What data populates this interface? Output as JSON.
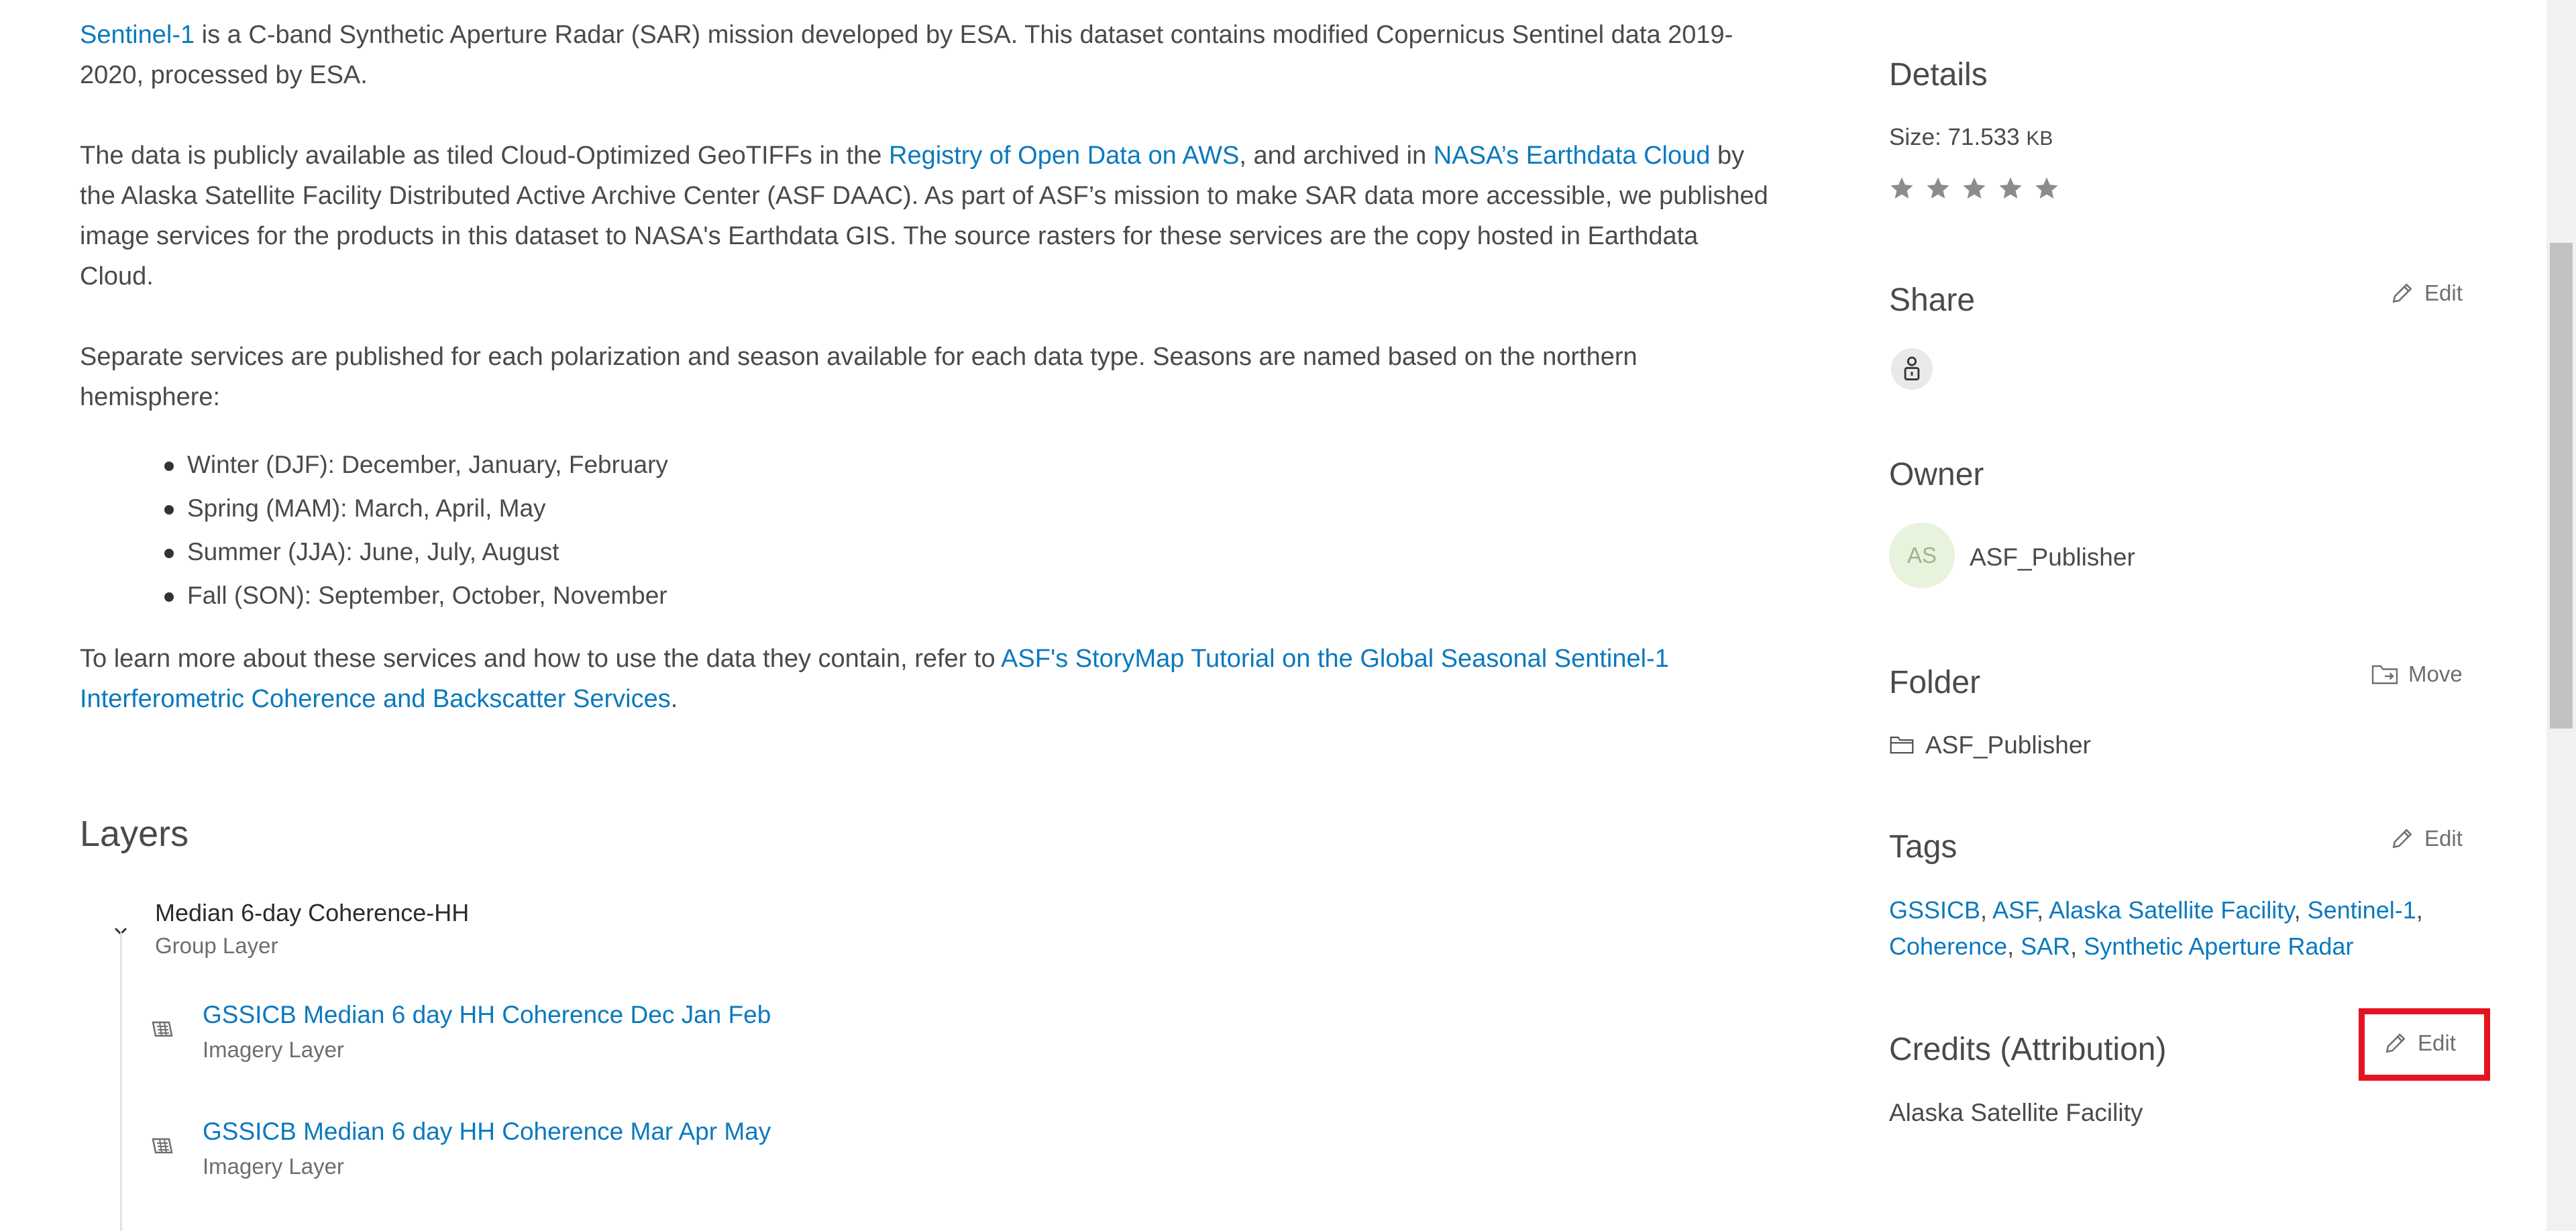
{
  "description": {
    "p1": {
      "link": "Sentinel-1",
      "text": " is a C-band Synthetic Aperture Radar (SAR) mission developed by ESA. This dataset contains modified Copernicus Sentinel data 2019-2020, processed by ESA."
    },
    "p2": {
      "t1": "The data is publicly available as tiled Cloud-Optimized GeoTIFFs in the ",
      "link1": "Registry of Open Data on AWS",
      "t2": ", and archived in ",
      "link2": "NASA’s Earthdata Cloud",
      "t3": " by the Alaska Satellite Facility Distributed Active Archive Center (ASF DAAC). As part of ASF’s mission to make SAR data more accessible, we published image services for the products in this dataset to NASA's Earthdata GIS. The source rasters for these services are the copy hosted in Earthdata Cloud."
    },
    "p3": "Separate services are published for each polarization and season available for each data type. Seasons are named based on the northern hemisphere:",
    "seasons": [
      "Winter (DJF): December, January, February",
      "Spring (MAM): March, April, May",
      "Summer (JJA): June, July, August",
      "Fall (SON): September, October, November"
    ],
    "p4": {
      "t1": "To learn more about these services and how to use the data they contain, refer to ",
      "link": "ASF's StoryMap Tutorial on the Global Seasonal Sentinel-1 Interferometric Coherence and Backscatter Services",
      "t2": "."
    }
  },
  "layers": {
    "heading": "Layers",
    "group": {
      "title": "Median 6-day Coherence-HH",
      "subtitle": "Group Layer"
    },
    "items": [
      {
        "title": "GSSICB Median 6 day HH Coherence Dec Jan Feb",
        "type": "Imagery Layer"
      },
      {
        "title": "GSSICB Median 6 day HH Coherence Mar Apr May",
        "type": "Imagery Layer"
      }
    ]
  },
  "details": {
    "heading": "Details",
    "size_label": "Size: 71.533",
    "size_unit": "KB",
    "rating": 0,
    "rating_max": 5
  },
  "share": {
    "heading": "Share",
    "edit": "Edit"
  },
  "owner": {
    "heading": "Owner",
    "initials": "AS",
    "name": "ASF_Publisher"
  },
  "folder": {
    "heading": "Folder",
    "move": "Move",
    "name": "ASF_Publisher"
  },
  "tags": {
    "heading": "Tags",
    "edit": "Edit",
    "line1": [
      "GSSICB",
      "ASF",
      "Alaska Satellite Facility",
      "Sentinel-1"
    ],
    "line2": [
      "Coherence",
      "SAR",
      "Synthetic Aperture Radar"
    ]
  },
  "credits": {
    "heading": "Credits (Attribution)",
    "edit": "Edit",
    "value": "Alaska Satellite Facility"
  },
  "colors": {
    "link": "#0b79be",
    "highlight": "#e3141e",
    "avatar_bg": "#e8f3dd"
  }
}
